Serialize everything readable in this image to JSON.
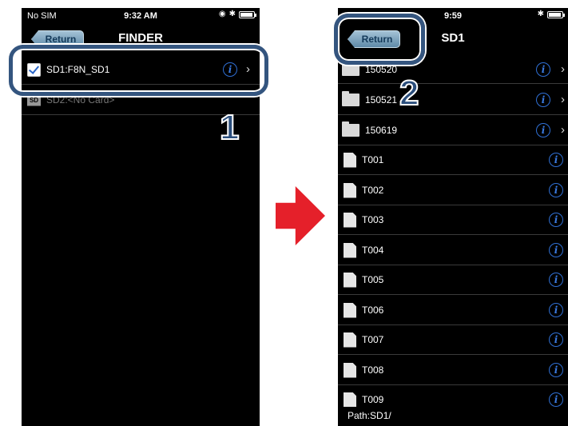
{
  "left_screen": {
    "status": {
      "carrier": "No SIM",
      "time": "9:32 AM"
    },
    "nav": {
      "back_label": "Return",
      "title": "FINDER"
    },
    "items": [
      {
        "label": "SD1:F8N_SD1"
      },
      {
        "label": "SD2:<No Card>"
      }
    ],
    "step": "1"
  },
  "right_screen": {
    "status": {
      "time": "9:59"
    },
    "nav": {
      "back_label": "Return",
      "title": "SD1"
    },
    "folders": [
      {
        "label": "150520"
      },
      {
        "label": "150521"
      },
      {
        "label": "150619"
      }
    ],
    "files": [
      {
        "label": "T001"
      },
      {
        "label": "T002"
      },
      {
        "label": "T003"
      },
      {
        "label": "T004"
      },
      {
        "label": "T005"
      },
      {
        "label": "T006"
      },
      {
        "label": "T007"
      },
      {
        "label": "T008"
      },
      {
        "label": "T009"
      }
    ],
    "path": "Path:SD1/",
    "step": "2"
  },
  "icons": {
    "info": "i",
    "chevron": "›",
    "sd_card": "SD",
    "bluetooth": "✱"
  },
  "colors": {
    "highlight": "#34557f",
    "arrow": "#e5202a",
    "info_blue": "#2f6fd4"
  }
}
